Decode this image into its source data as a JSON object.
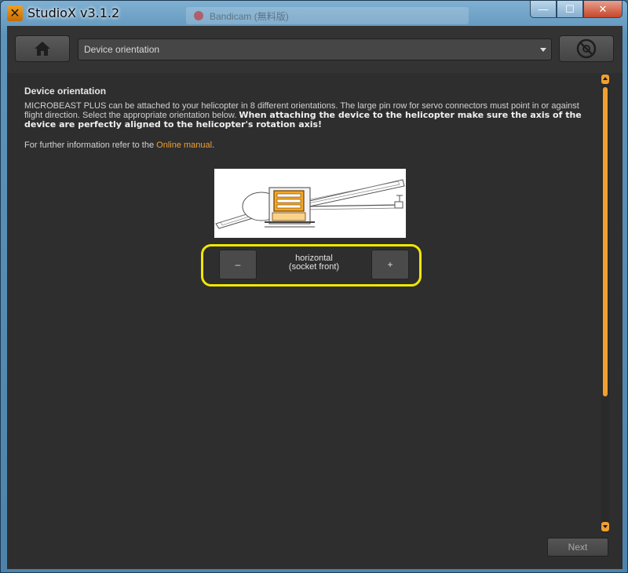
{
  "window": {
    "title": "StudioX v3.1.2",
    "background_window_title": "Bandicam (無料版)",
    "minimize_symbol": "—",
    "maximize_symbol": "☐",
    "close_symbol": "✕"
  },
  "toolbar": {
    "home_icon": "home-icon",
    "section_select": "Device orientation",
    "settings_icon": "settings-icon"
  },
  "content": {
    "heading": "Device orientation",
    "para_intro": "MICROBEAST PLUS can be attached to your helicopter in 8 different orientations. The large pin row for servo connectors must point in or against flight direction. Select the appropriate orientation below. ",
    "para_bold": "When attaching the device to the helicopter make sure the axis of the device are perfectly aligned to the helicopter's rotation axis!",
    "info_prefix": "For further information refer to the ",
    "info_link": "Online manual",
    "info_suffix": "."
  },
  "orientation": {
    "minus_label": "–",
    "plus_label": "+",
    "label_line1": "horizontal",
    "label_line2": "(socket front)"
  },
  "footer": {
    "next_label": "Next"
  },
  "colors": {
    "accent": "#f0a030",
    "highlight": "#f0e800",
    "panel": "#2e2e2e"
  }
}
